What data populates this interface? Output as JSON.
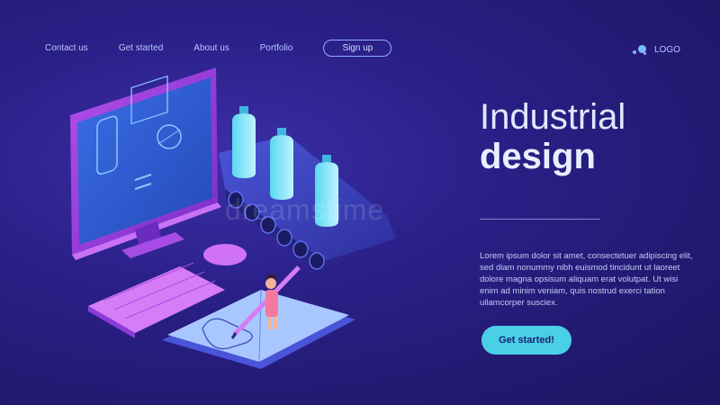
{
  "nav": {
    "items": [
      "Contact us",
      "Get started",
      "About us",
      "Portfolio"
    ],
    "signup_label": "Sign up"
  },
  "logo": {
    "text": "LOGO"
  },
  "hero": {
    "title_line1": "Industrial",
    "title_line2": "design",
    "description": "Lorem ipsum dolor sit amet, consectetuer adipiscing elit, sed diam nonummy nibh euismod tincidunt ut laoreet dolore magna opsisum aliquam erat volutpat. Ut wisi enim ad minim veniam, quis nostrud exerci tation ullamcorper susciex.",
    "cta_label": "Get started!"
  },
  "watermark": "dreamstime",
  "colors": {
    "accent": "#49d0e6",
    "background": "#2a1f86",
    "monitor": "#8d3bd9"
  }
}
